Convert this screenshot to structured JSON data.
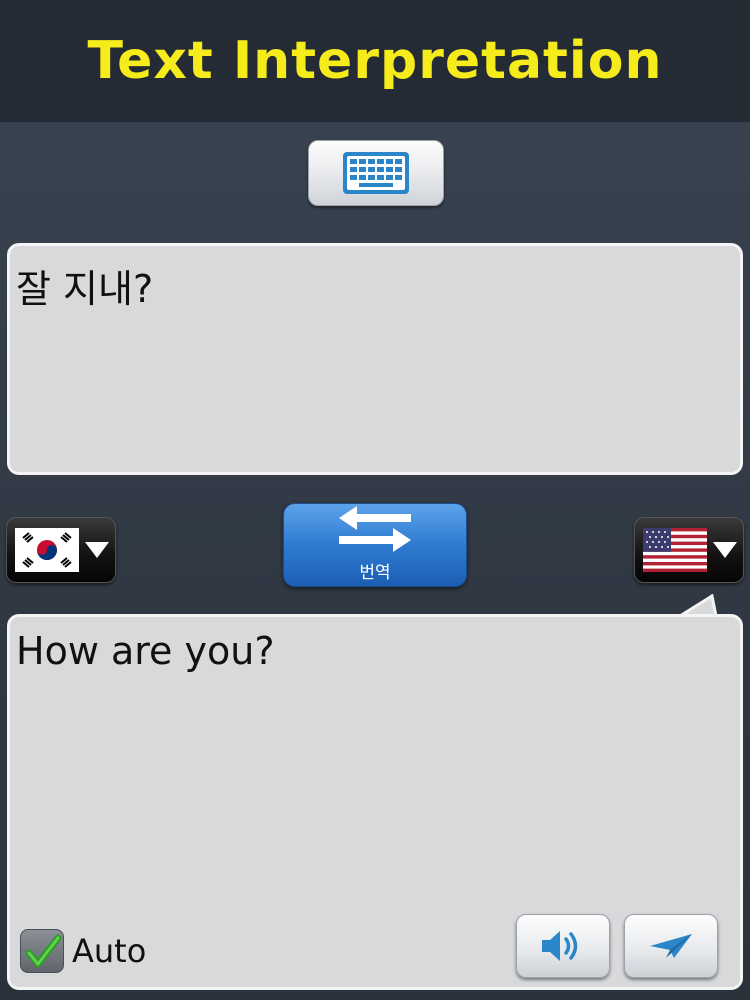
{
  "header": {
    "title": "Text Interpretation"
  },
  "input": {
    "text": "잘 지내?"
  },
  "output": {
    "text": "How are you?"
  },
  "translate_button": {
    "label": "번역"
  },
  "source_language": {
    "flag_icon": "south-korea-flag-icon"
  },
  "target_language": {
    "flag_icon": "united-states-flag-icon"
  },
  "auto": {
    "label": "Auto",
    "checked": true
  },
  "colors": {
    "title": "#f6ec1c",
    "header_bg": "#252b34",
    "bubble_bg": "#d8d9db",
    "translate_button": "#2f7bd2",
    "icon_blue": "#2a86c9"
  }
}
